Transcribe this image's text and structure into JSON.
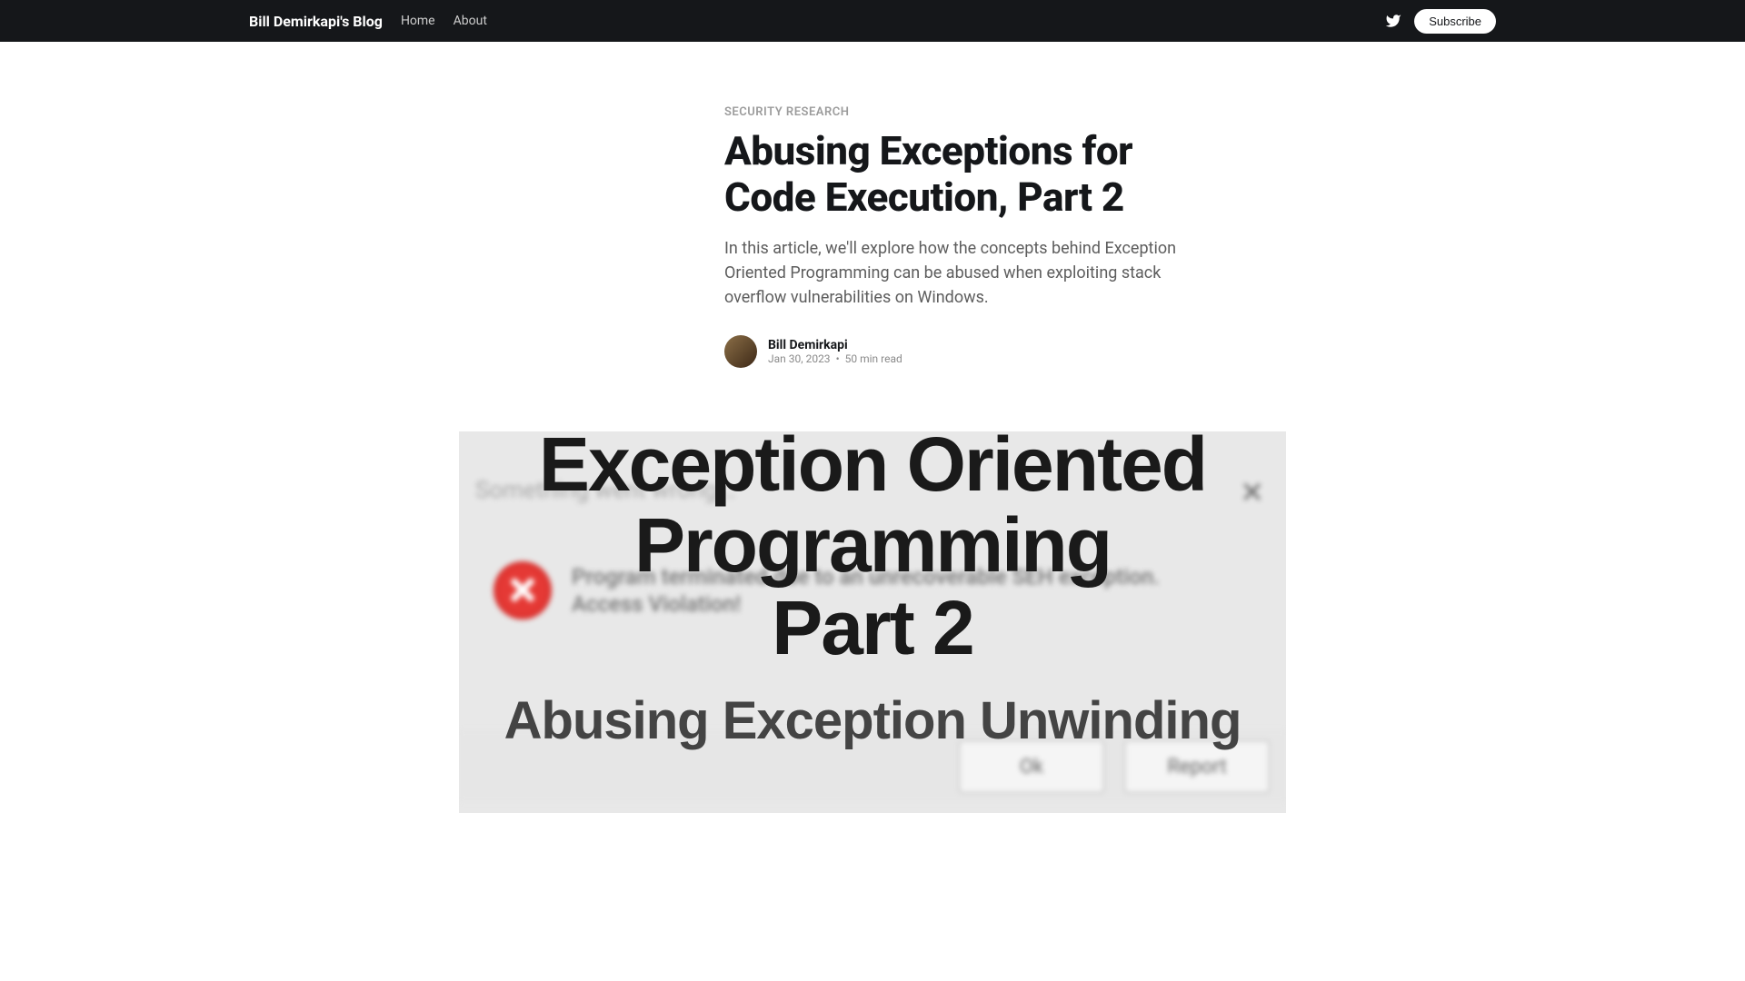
{
  "header": {
    "logo": "Bill Demirkapi's Blog",
    "nav": {
      "home": "Home",
      "about": "About"
    },
    "subscribe": "Subscribe"
  },
  "article": {
    "category": "SECURITY RESEARCH",
    "title": "Abusing Exceptions for Code Execution, Part 2",
    "excerpt": "In this article, we'll explore how the concepts behind Exception Oriented Programming can be abused when exploiting stack overflow vulnerabilities on Windows.",
    "author": {
      "name": "Bill Demirkapi",
      "date": "Jan 30, 2023",
      "read_time": "50 min read"
    }
  },
  "hero": {
    "bg_text": "Something went wrong...",
    "error_text1": "Program terminated due to an unrecoverable SEH exception.",
    "error_text2": "Access Violation!",
    "btn_ok": "Ok",
    "btn_report": "Report",
    "title_line1": "Exception Oriented",
    "title_line2": "Programming",
    "title_line3": "Part 2",
    "subtitle": "Abusing Exception Unwinding"
  }
}
